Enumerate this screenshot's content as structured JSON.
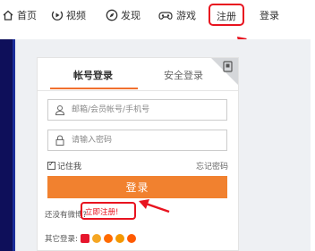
{
  "nav": {
    "home": "首页",
    "video": "视频",
    "discover": "发现",
    "games": "游戏",
    "register": "注册",
    "login": "登录"
  },
  "login_card": {
    "tab_account": "帐号登录",
    "tab_secure": "安全登录",
    "username_placeholder": "邮箱/会员帐号/手机号",
    "password_placeholder": "请输入密码",
    "remember_me": "记住我",
    "forgot_password": "忘记密码",
    "login_button": "登录",
    "no_account_text": "还没有微博?",
    "register_now": "立即注册!",
    "other_login": "其它登录:"
  },
  "colors": {
    "accent": "#f1812f",
    "highlight": "#e8131f",
    "left_panel": "#0e0f5a"
  },
  "icons": {
    "home": "home-icon",
    "video": "play-circle-icon",
    "discover": "compass-icon",
    "games": "gamepad-icon",
    "qr": "qrcode-icon",
    "user": "user-icon",
    "lock": "lock-icon",
    "social": [
      "weibo-icon",
      "qq-icon",
      "taobao-icon",
      "wechat-icon",
      "alipay-icon"
    ]
  }
}
